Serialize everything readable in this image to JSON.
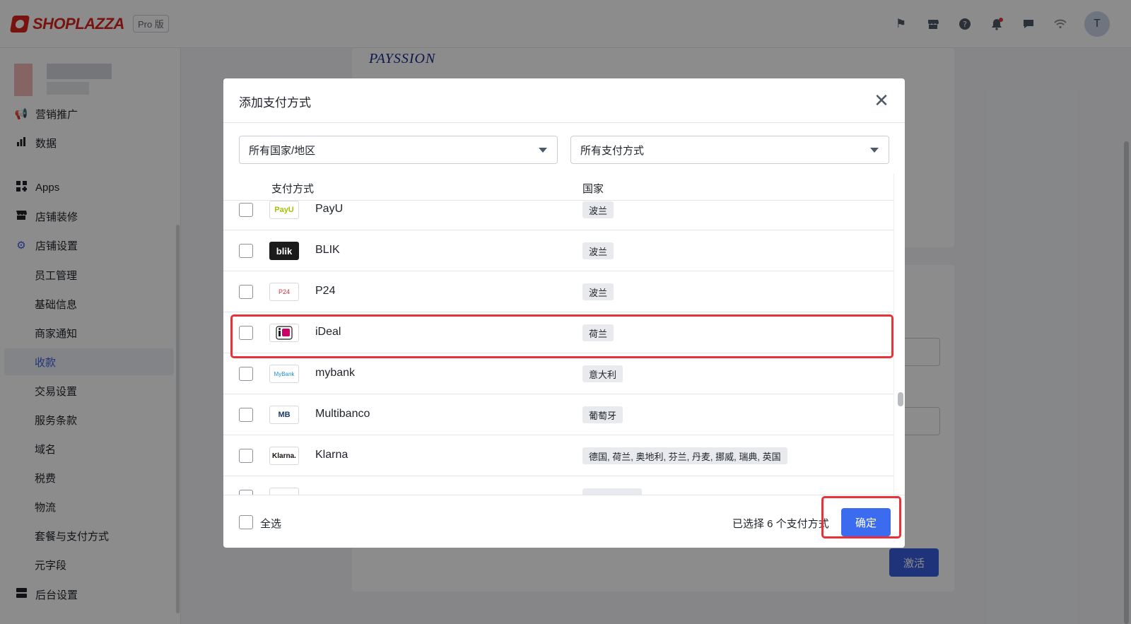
{
  "topbar": {
    "brand": "SHOPLAZZA",
    "plan_badge": "Pro 版",
    "avatar_initial": "T",
    "icons": [
      "flag-icon",
      "store-icon",
      "help-icon",
      "bell-icon",
      "chat-icon",
      "wifi-icon"
    ]
  },
  "sidebar": {
    "items": [
      {
        "label": "营销推广",
        "icon": "megaphone-icon"
      },
      {
        "label": "数据",
        "icon": "bar-chart-icon"
      },
      {
        "label": "Apps",
        "icon": "apps-icon"
      },
      {
        "label": "店铺装修",
        "icon": "store-icon"
      },
      {
        "label": "店铺设置",
        "icon": "gear-icon"
      }
    ],
    "sub_items": [
      {
        "label": "员工管理"
      },
      {
        "label": "基础信息"
      },
      {
        "label": "商家通知"
      },
      {
        "label": "收款",
        "active": true
      },
      {
        "label": "交易设置"
      },
      {
        "label": "服务条款"
      },
      {
        "label": "域名"
      },
      {
        "label": "税费"
      },
      {
        "label": "物流"
      },
      {
        "label": "套餐与支付方式"
      },
      {
        "label": "元字段"
      }
    ],
    "bottom_item": {
      "label": "后台设置",
      "icon": "server-icon"
    }
  },
  "background": {
    "provider_logo": "PAYSSION",
    "activate_label": "激活"
  },
  "modal": {
    "title": "添加支付方式",
    "country_filter": "所有国家/地区",
    "method_filter": "所有支付方式",
    "columns": {
      "method": "支付方式",
      "country": "国家"
    },
    "rows": [
      {
        "name": "PayU",
        "logo_text": "PayU",
        "country": "波兰",
        "logo_color": "#a6c307",
        "logo_bg": "#ffffff"
      },
      {
        "name": "BLIK",
        "logo_text": "blik",
        "country": "波兰",
        "logo_color": "#ffffff",
        "logo_bg": "#1b1b1b"
      },
      {
        "name": "P24",
        "logo_text": "P24",
        "country": "波兰",
        "logo_color": "#d13239",
        "logo_bg": "#ffffff"
      },
      {
        "name": "iDeal",
        "logo_text": "iD",
        "country": "荷兰",
        "logo_color": "#cc0066",
        "logo_bg": "#ffffff"
      },
      {
        "name": "mybank",
        "logo_text": "MyBank",
        "country": "意大利",
        "logo_color": "#1a8fd6",
        "logo_bg": "#ffffff"
      },
      {
        "name": "Multibanco",
        "logo_text": "MB",
        "country": "葡萄牙",
        "logo_color": "#1b3a6b",
        "logo_bg": "#ffffff"
      },
      {
        "name": "Klarna",
        "logo_text": "Klarna.",
        "country": "德国, 荷兰, 奥地利, 芬兰, 丹麦, 挪威, 瑞典, 英国",
        "logo_color": "#17120f",
        "logo_bg": "#ffffff"
      }
    ],
    "select_all_label": "全选",
    "selected_count": "已选择 6 个支付方式",
    "confirm_label": "确定"
  },
  "colors": {
    "accent": "#3b6cf0",
    "highlight": "#e8323a",
    "brand": "#d9261c"
  }
}
